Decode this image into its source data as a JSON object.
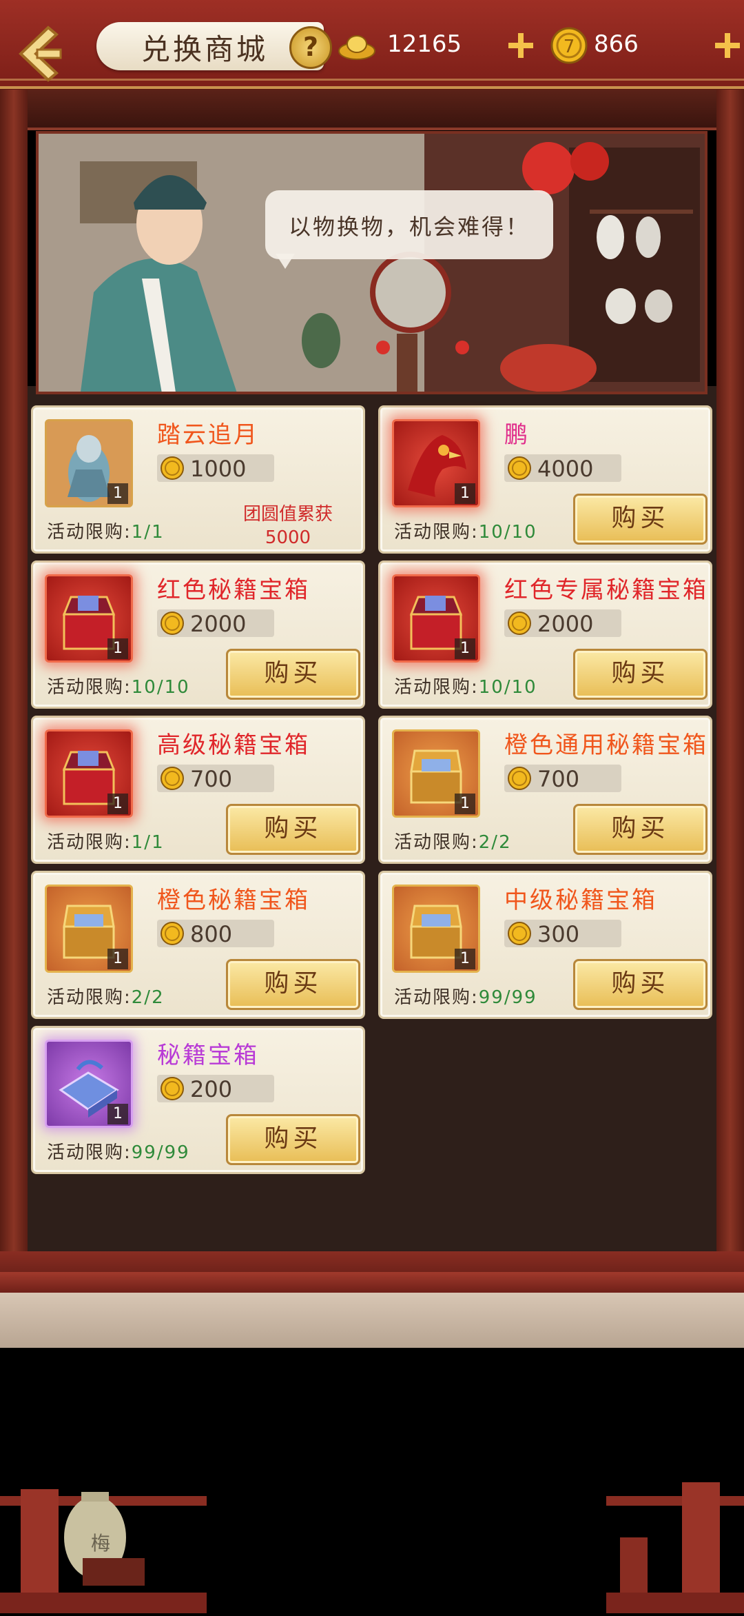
{
  "header": {
    "title": "兑换商城",
    "help": "?"
  },
  "currency": {
    "gold_ingot": {
      "icon": "gold-ingot-icon",
      "value": "12165"
    },
    "coin": {
      "icon": "coin-icon",
      "value": "866"
    }
  },
  "banner": {
    "speech": "以物换物，机会难得！"
  },
  "items": [
    {
      "name": "踏云追月",
      "price": "1000",
      "qty": "1",
      "limit_label": "活动限购:",
      "limit": "1/1",
      "note_line1": "团圆值累获",
      "note_line2": "5000"
    },
    {
      "name": "鹏",
      "price": "4000",
      "qty": "1",
      "limit_label": "活动限购:",
      "limit": "10/10",
      "button": "购买"
    },
    {
      "name": "红色秘籍宝箱",
      "price": "2000",
      "qty": "1",
      "limit_label": "活动限购:",
      "limit": "10/10",
      "button": "购买"
    },
    {
      "name": "红色专属秘籍宝箱",
      "price": "2000",
      "qty": "1",
      "limit_label": "活动限购:",
      "limit": "10/10",
      "button": "购买"
    },
    {
      "name": "高级秘籍宝箱",
      "price": "700",
      "qty": "1",
      "limit_label": "活动限购:",
      "limit": "1/1",
      "button": "购买"
    },
    {
      "name": "橙色通用秘籍宝箱",
      "price": "700",
      "qty": "1",
      "limit_label": "活动限购:",
      "limit": "2/2",
      "button": "购买"
    },
    {
      "name": "橙色秘籍宝箱",
      "price": "800",
      "qty": "1",
      "limit_label": "活动限购:",
      "limit": "2/2",
      "button": "购买"
    },
    {
      "name": "中级秘籍宝箱",
      "price": "300",
      "qty": "1",
      "limit_label": "活动限购:",
      "limit": "99/99",
      "button": "购买"
    },
    {
      "name": "秘籍宝箱",
      "price": "200",
      "qty": "1",
      "limit_label": "活动限购:",
      "limit": "99/99",
      "button": "购买"
    }
  ],
  "decor": {
    "jar_label": "梅"
  },
  "colors": {
    "accent_red": "#9e2f25",
    "gold_button": "#e8bd55",
    "limit_green": "#2f8a3a"
  }
}
